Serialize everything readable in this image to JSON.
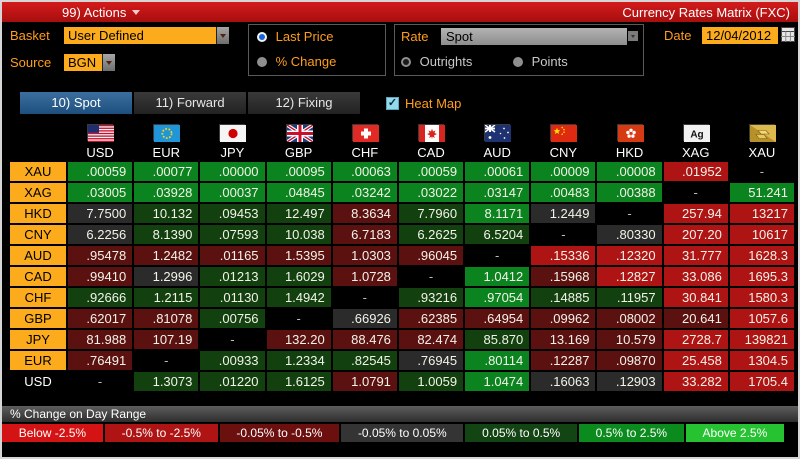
{
  "titlebar": {
    "actions_label": "99) Actions",
    "title": "Currency Rates Matrix (FXC)"
  },
  "controls": {
    "basket_label": "Basket",
    "basket_value": "User Defined",
    "source_label": "Source",
    "source_value": "BGN",
    "price_radio": "Last Price",
    "change_radio": "% Change",
    "rate_label": "Rate",
    "rate_value": "Spot",
    "outrights_radio": "Outrights",
    "points_radio": "Points",
    "date_label": "Date",
    "date_value": "12/04/2012",
    "calendar_icon": "calendar-icon"
  },
  "tabs": [
    {
      "label": "10) Spot",
      "active": true
    },
    {
      "label": "11) Forward",
      "active": false
    },
    {
      "label": "12) Fixing",
      "active": false
    }
  ],
  "heatmap": {
    "label": "Heat Map",
    "checked": true
  },
  "colors": {
    "g2": "#0b831f",
    "g1": "#12400f",
    "n": "#2b2b2b",
    "r1": "#5c1111",
    "r2": "#ae1414",
    "blk": "#000000"
  },
  "matrix": {
    "columns": [
      {
        "code": "USD",
        "icon": "us-flag-icon"
      },
      {
        "code": "EUR",
        "icon": "eu-flag-icon"
      },
      {
        "code": "JPY",
        "icon": "japan-flag-icon"
      },
      {
        "code": "GBP",
        "icon": "uk-flag-icon"
      },
      {
        "code": "CHF",
        "icon": "switzerland-flag-icon"
      },
      {
        "code": "CAD",
        "icon": "canada-flag-icon"
      },
      {
        "code": "AUD",
        "icon": "australia-flag-icon"
      },
      {
        "code": "CNY",
        "icon": "china-flag-icon"
      },
      {
        "code": "HKD",
        "icon": "hong-kong-flag-icon"
      },
      {
        "code": "XAG",
        "icon": "silver-icon"
      },
      {
        "code": "XAU",
        "icon": "gold-icon"
      }
    ],
    "rows": [
      {
        "label": "XAU",
        "plain": false,
        "cells": [
          {
            "v": ".00059",
            "c": "g2"
          },
          {
            "v": ".00077",
            "c": "g2"
          },
          {
            "v": ".00000",
            "c": "g2"
          },
          {
            "v": ".00095",
            "c": "g2"
          },
          {
            "v": ".00063",
            "c": "g2"
          },
          {
            "v": ".00059",
            "c": "g2"
          },
          {
            "v": ".00061",
            "c": "g2"
          },
          {
            "v": ".00009",
            "c": "g2"
          },
          {
            "v": ".00008",
            "c": "g2"
          },
          {
            "v": ".01952",
            "c": "r2"
          },
          {
            "v": "-",
            "c": "blk"
          }
        ]
      },
      {
        "label": "XAG",
        "plain": false,
        "cells": [
          {
            "v": ".03005",
            "c": "g2"
          },
          {
            "v": ".03928",
            "c": "g2"
          },
          {
            "v": ".00037",
            "c": "g2"
          },
          {
            "v": ".04845",
            "c": "g2"
          },
          {
            "v": ".03242",
            "c": "g2"
          },
          {
            "v": ".03022",
            "c": "g2"
          },
          {
            "v": ".03147",
            "c": "g2"
          },
          {
            "v": ".00483",
            "c": "g2"
          },
          {
            "v": ".00388",
            "c": "g2"
          },
          {
            "v": "-",
            "c": "blk"
          },
          {
            "v": "51.241",
            "c": "g2"
          }
        ]
      },
      {
        "label": "HKD",
        "plain": false,
        "cells": [
          {
            "v": "7.7500",
            "c": "n"
          },
          {
            "v": "10.132",
            "c": "g1"
          },
          {
            "v": ".09453",
            "c": "g1"
          },
          {
            "v": "12.497",
            "c": "g1"
          },
          {
            "v": "8.3634",
            "c": "r1"
          },
          {
            "v": "7.7960",
            "c": "g1"
          },
          {
            "v": "8.1171",
            "c": "g2"
          },
          {
            "v": "1.2449",
            "c": "n"
          },
          {
            "v": "-",
            "c": "blk"
          },
          {
            "v": "257.94",
            "c": "r2"
          },
          {
            "v": "13217",
            "c": "r2"
          }
        ]
      },
      {
        "label": "CNY",
        "plain": false,
        "cells": [
          {
            "v": "6.2256",
            "c": "n"
          },
          {
            "v": "8.1390",
            "c": "g1"
          },
          {
            "v": ".07593",
            "c": "g1"
          },
          {
            "v": "10.038",
            "c": "g1"
          },
          {
            "v": "6.7183",
            "c": "r1"
          },
          {
            "v": "6.2625",
            "c": "g1"
          },
          {
            "v": "6.5204",
            "c": "g1"
          },
          {
            "v": "-",
            "c": "blk"
          },
          {
            "v": ".80330",
            "c": "n"
          },
          {
            "v": "207.20",
            "c": "r2"
          },
          {
            "v": "10617",
            "c": "r2"
          }
        ]
      },
      {
        "label": "AUD",
        "plain": false,
        "cells": [
          {
            "v": ".95478",
            "c": "r1"
          },
          {
            "v": "1.2482",
            "c": "r1"
          },
          {
            "v": ".01165",
            "c": "r1"
          },
          {
            "v": "1.5395",
            "c": "r1"
          },
          {
            "v": "1.0303",
            "c": "r1"
          },
          {
            "v": ".96045",
            "c": "r1"
          },
          {
            "v": "-",
            "c": "blk"
          },
          {
            "v": ".15336",
            "c": "r2"
          },
          {
            "v": ".12320",
            "c": "r2"
          },
          {
            "v": "31.777",
            "c": "r2"
          },
          {
            "v": "1628.3",
            "c": "r2"
          }
        ]
      },
      {
        "label": "CAD",
        "plain": false,
        "cells": [
          {
            "v": ".99410",
            "c": "r1"
          },
          {
            "v": "1.2996",
            "c": "n"
          },
          {
            "v": ".01213",
            "c": "g1"
          },
          {
            "v": "1.6029",
            "c": "g1"
          },
          {
            "v": "1.0728",
            "c": "r1"
          },
          {
            "v": "-",
            "c": "blk"
          },
          {
            "v": "1.0412",
            "c": "g2"
          },
          {
            "v": ".15968",
            "c": "r1"
          },
          {
            "v": ".12827",
            "c": "r2"
          },
          {
            "v": "33.086",
            "c": "r2"
          },
          {
            "v": "1695.3",
            "c": "r2"
          }
        ]
      },
      {
        "label": "CHF",
        "plain": false,
        "cells": [
          {
            "v": ".92666",
            "c": "g1"
          },
          {
            "v": "1.2115",
            "c": "g1"
          },
          {
            "v": ".01130",
            "c": "g1"
          },
          {
            "v": "1.4942",
            "c": "g1"
          },
          {
            "v": "-",
            "c": "blk"
          },
          {
            "v": ".93216",
            "c": "g1"
          },
          {
            "v": ".97054",
            "c": "g2"
          },
          {
            "v": ".14885",
            "c": "g1"
          },
          {
            "v": ".11957",
            "c": "g1"
          },
          {
            "v": "30.841",
            "c": "r2"
          },
          {
            "v": "1580.3",
            "c": "r2"
          }
        ]
      },
      {
        "label": "GBP",
        "plain": false,
        "cells": [
          {
            "v": ".62017",
            "c": "r1"
          },
          {
            "v": ".81078",
            "c": "r1"
          },
          {
            "v": ".00756",
            "c": "g1"
          },
          {
            "v": "-",
            "c": "blk"
          },
          {
            "v": ".66926",
            "c": "n"
          },
          {
            "v": ".62385",
            "c": "r1"
          },
          {
            "v": ".64954",
            "c": "r1"
          },
          {
            "v": ".09962",
            "c": "r1"
          },
          {
            "v": ".08002",
            "c": "r1"
          },
          {
            "v": "20.641",
            "c": "r1"
          },
          {
            "v": "1057.6",
            "c": "r2"
          }
        ]
      },
      {
        "label": "JPY",
        "plain": false,
        "cells": [
          {
            "v": "81.988",
            "c": "r1"
          },
          {
            "v": "107.19",
            "c": "r1"
          },
          {
            "v": "-",
            "c": "blk"
          },
          {
            "v": "132.20",
            "c": "r1"
          },
          {
            "v": "88.476",
            "c": "r1"
          },
          {
            "v": "82.474",
            "c": "r1"
          },
          {
            "v": "85.870",
            "c": "g1"
          },
          {
            "v": "13.169",
            "c": "r1"
          },
          {
            "v": "10.579",
            "c": "r1"
          },
          {
            "v": "2728.7",
            "c": "r2"
          },
          {
            "v": "139821",
            "c": "r2"
          }
        ]
      },
      {
        "label": "EUR",
        "plain": false,
        "cells": [
          {
            "v": ".76491",
            "c": "r1"
          },
          {
            "v": "-",
            "c": "blk"
          },
          {
            "v": ".00933",
            "c": "g1"
          },
          {
            "v": "1.2334",
            "c": "g1"
          },
          {
            "v": ".82545",
            "c": "g1"
          },
          {
            "v": ".76945",
            "c": "n"
          },
          {
            "v": ".80114",
            "c": "g2"
          },
          {
            "v": ".12287",
            "c": "r1"
          },
          {
            "v": ".09870",
            "c": "r1"
          },
          {
            "v": "25.458",
            "c": "r2"
          },
          {
            "v": "1304.5",
            "c": "r2"
          }
        ]
      },
      {
        "label": "USD",
        "plain": true,
        "cells": [
          {
            "v": "-",
            "c": "blk"
          },
          {
            "v": "1.3073",
            "c": "g1"
          },
          {
            "v": ".01220",
            "c": "g1"
          },
          {
            "v": "1.6125",
            "c": "g1"
          },
          {
            "v": "1.0791",
            "c": "r1"
          },
          {
            "v": "1.0059",
            "c": "g1"
          },
          {
            "v": "1.0474",
            "c": "g2"
          },
          {
            "v": ".16063",
            "c": "n"
          },
          {
            "v": ".12903",
            "c": "n"
          },
          {
            "v": "33.282",
            "c": "r2"
          },
          {
            "v": "1705.4",
            "c": "r2"
          }
        ]
      }
    ]
  },
  "legend": {
    "title": "% Change on Day Range",
    "items": [
      {
        "label": "Below -2.5%",
        "color": "#d41414"
      },
      {
        "label": "-0.5% to -2.5%",
        "color": "#ae1414"
      },
      {
        "label": "-0.05% to -0.5%",
        "color": "#6b0f0f"
      },
      {
        "label": "-0.05% to 0.05%",
        "color": "#343434"
      },
      {
        "label": "0.05% to 0.5%",
        "color": "#134413"
      },
      {
        "label": "0.5% to 2.5%",
        "color": "#0b8a1e"
      },
      {
        "label": "Above 2.5%",
        "color": "#27c232"
      }
    ]
  }
}
